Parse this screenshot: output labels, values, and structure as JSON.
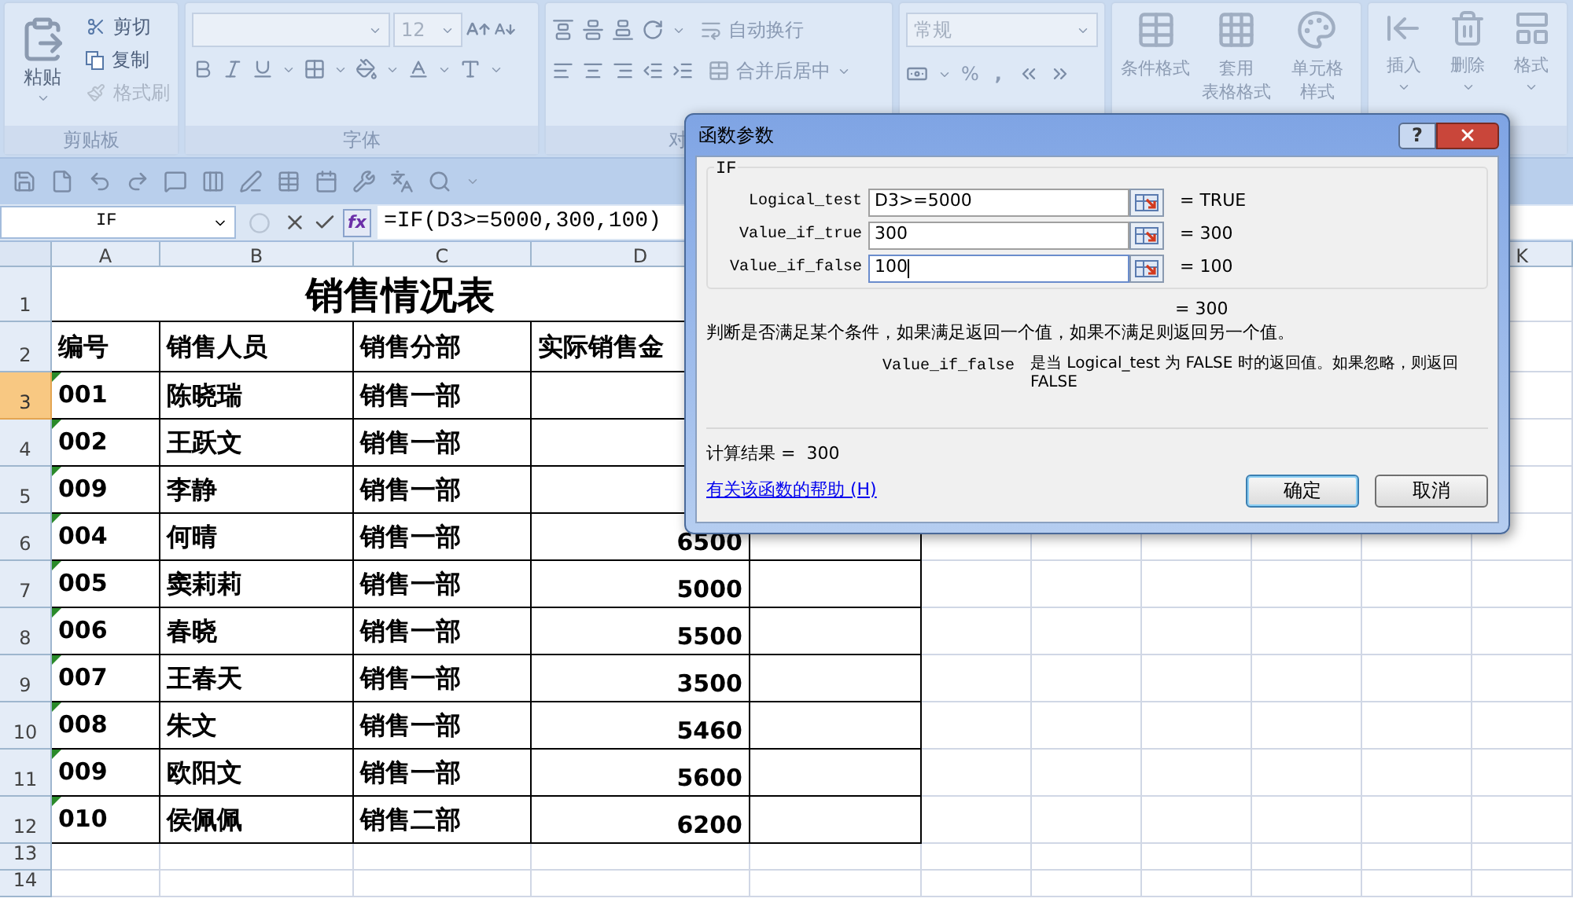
{
  "ribbon": {
    "clipboard": {
      "label": "剪贴板",
      "paste": "粘贴",
      "commands": [
        {
          "label": "剪切",
          "disabled": false
        },
        {
          "label": "复制",
          "disabled": false
        },
        {
          "label": "格式刷",
          "disabled": true
        }
      ]
    },
    "font": {
      "label": "字体",
      "size": "12"
    },
    "alignment": {
      "label": "对",
      "wrap": "自动换行",
      "merge": "合并后居中"
    },
    "number": {
      "format": "常规",
      "percent": "%",
      "comma": ","
    },
    "styles": [
      {
        "kind": "conditional",
        "lines": [
          "条件格式"
        ]
      },
      {
        "kind": "table",
        "lines": [
          "套用",
          "表格格式"
        ]
      },
      {
        "kind": "cell",
        "lines": [
          "单元格",
          "样式"
        ]
      }
    ],
    "cells": [
      {
        "kind": "insert",
        "label": "插入"
      },
      {
        "kind": "delete",
        "label": "删除"
      },
      {
        "kind": "format",
        "label": "格式"
      }
    ]
  },
  "formula_bar": {
    "name_box": "IF",
    "fx": "fx",
    "formula": "=IF(D3>=5000,300,100)"
  },
  "sheet": {
    "columns": [
      {
        "label": "A"
      },
      {
        "label": "B"
      },
      {
        "label": "C"
      },
      {
        "label": "D"
      },
      {
        "label": "K"
      }
    ],
    "row_numbers": [
      {
        "label": "1",
        "selected": false
      },
      {
        "label": "2",
        "selected": false
      },
      {
        "label": "3",
        "selected": true
      },
      {
        "label": "4",
        "selected": false
      },
      {
        "label": "5",
        "selected": false
      },
      {
        "label": "6",
        "selected": false
      },
      {
        "label": "7",
        "selected": false
      },
      {
        "label": "8",
        "selected": false
      },
      {
        "label": "9",
        "selected": false
      },
      {
        "label": "10",
        "selected": false
      },
      {
        "label": "11",
        "selected": false
      },
      {
        "label": "12",
        "selected": false
      },
      {
        "label": "13",
        "selected": false
      },
      {
        "label": "14",
        "selected": false
      }
    ],
    "title": "销售情况表",
    "header_row": [
      "编号",
      "销售人员",
      "销售分部",
      "实际销售金"
    ],
    "rows": [
      {
        "number": "001",
        "name": "陈晓瑞",
        "dept": "销售一部"
      },
      {
        "number": "002",
        "name": "王跃文",
        "dept": "销售一部"
      },
      {
        "number": "009",
        "name": "李静",
        "dept": "销售一部"
      },
      {
        "number": "004",
        "name": "何晴",
        "dept": "销售一部",
        "sales": "6500"
      },
      {
        "number": "005",
        "name": "窦莉莉",
        "dept": "销售一部",
        "sales": "5000"
      },
      {
        "number": "006",
        "name": "春晓",
        "dept": "销售一部",
        "sales": "5500"
      },
      {
        "number": "007",
        "name": "王春天",
        "dept": "销售一部",
        "sales": "3500"
      },
      {
        "number": "008",
        "name": "朱文",
        "dept": "销售一部",
        "sales": "5460"
      },
      {
        "number": "009",
        "name": "欧阳文",
        "dept": "销售一部",
        "sales": "5600"
      },
      {
        "number": "010",
        "name": "侯佩佩",
        "dept": "销售二部",
        "sales": "6200"
      }
    ]
  },
  "dialog": {
    "title": "函数参数",
    "help": "?",
    "function": "IF",
    "args": [
      {
        "label": "Logical_test",
        "value": "D3>=5000",
        "result": "= TRUE",
        "focused": false
      },
      {
        "label": "Value_if_true",
        "value": "300",
        "result": "= 300",
        "focused": false
      },
      {
        "label": "Value_if_false",
        "value": "100",
        "result": "= 100",
        "focused": true
      }
    ],
    "formula_result": "= 300",
    "description": "判断是否满足某个条件，如果满足返回一个值，如果不满足则返回另一个值。",
    "arg_name": "Value_if_false",
    "arg_help": "是当 Logical_test 为 FALSE 时的返回值。如果忽略，则返回 FALSE",
    "calc_result": "计算结果 =  300",
    "help_link": "有关该函数的帮助 (H)",
    "buttons": [
      {
        "label": "确定",
        "default": true
      },
      {
        "label": "取消",
        "default": false
      }
    ]
  }
}
